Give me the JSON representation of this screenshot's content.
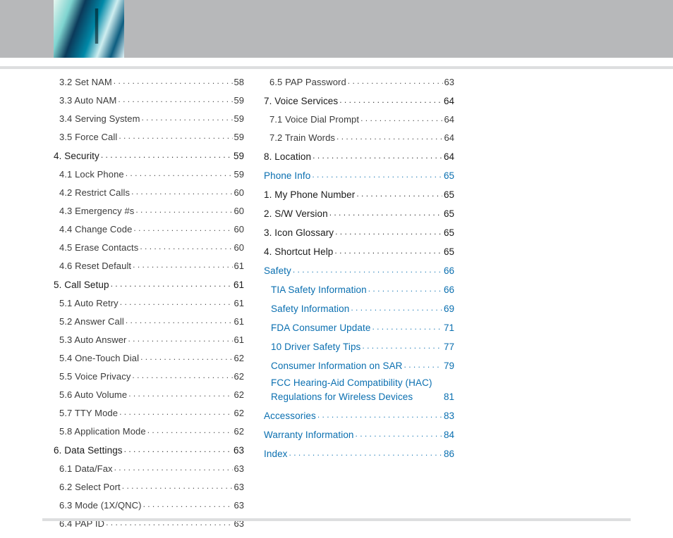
{
  "columns": [
    [
      {
        "style": "indent1",
        "label": "3.2 Set NAM",
        "page": "58"
      },
      {
        "style": "indent1",
        "label": "3.3 Auto NAM",
        "page": "59"
      },
      {
        "style": "indent1",
        "label": "3.4 Serving System",
        "page": "59"
      },
      {
        "style": "indent1",
        "label": "3.5 Force Call",
        "page": "59"
      },
      {
        "style": "section",
        "label": "4. Security",
        "page": "59"
      },
      {
        "style": "indent1",
        "label": "4.1 Lock Phone",
        "page": "59"
      },
      {
        "style": "indent1",
        "label": "4.2 Restrict Calls",
        "page": "60"
      },
      {
        "style": "indent1",
        "label": "4.3 Emergency #s",
        "page": "60"
      },
      {
        "style": "indent1",
        "label": "4.4 Change Code",
        "page": "60"
      },
      {
        "style": "indent1",
        "label": "4.5 Erase Contacts",
        "page": "60"
      },
      {
        "style": "indent1",
        "label": "4.6 Reset Default",
        "page": "61"
      },
      {
        "style": "section",
        "label": "5. Call Setup",
        "page": "61"
      },
      {
        "style": "indent1",
        "label": "5.1 Auto Retry",
        "page": "61"
      },
      {
        "style": "indent1",
        "label": "5.2 Answer Call",
        "page": "61"
      },
      {
        "style": "indent1",
        "label": "5.3 Auto Answer",
        "page": "61"
      },
      {
        "style": "indent1",
        "label": "5.4 One-Touch Dial",
        "page": "62"
      },
      {
        "style": "indent1",
        "label": "5.5 Voice Privacy",
        "page": "62"
      },
      {
        "style": "indent1",
        "label": "5.6 Auto Volume",
        "page": "62"
      },
      {
        "style": "indent1",
        "label": "5.7 TTY Mode",
        "page": "62"
      },
      {
        "style": "indent1",
        "label": "5.8 Application Mode",
        "page": "62"
      },
      {
        "style": "section",
        "label": "6. Data Settings",
        "page": "63"
      },
      {
        "style": "indent1",
        "label": "6.1 Data/Fax",
        "page": "63"
      },
      {
        "style": "indent1",
        "label": "6.2 Select Port",
        "page": "63"
      },
      {
        "style": "indent1",
        "label": "6.3 Mode (1X/QNC)",
        "page": "63"
      },
      {
        "style": "indent1",
        "label": "6.4 PAP ID",
        "page": "63"
      }
    ],
    [
      {
        "style": "indent1",
        "label": "6.5 PAP Password",
        "page": "63"
      },
      {
        "style": "section",
        "label": "7. Voice Services",
        "page": "64"
      },
      {
        "style": "indent1",
        "label": "7.1 Voice Dial Prompt",
        "page": "64"
      },
      {
        "style": "indent1",
        "label": "7.2 Train Words",
        "page": "64"
      },
      {
        "style": "section",
        "label": "8. Location",
        "page": "64"
      },
      {
        "style": "link",
        "label": "Phone Info",
        "page": "65"
      },
      {
        "style": "section",
        "label": "1. My Phone Number",
        "page": "65"
      },
      {
        "style": "section",
        "label": "2. S/W Version",
        "page": "65"
      },
      {
        "style": "section",
        "label": "3. Icon Glossary",
        "page": "65"
      },
      {
        "style": "section",
        "label": "4. Shortcut Help",
        "page": "65"
      },
      {
        "style": "link",
        "label": "Safety",
        "page": "66",
        "spaced": true
      },
      {
        "style": "link",
        "label": "TIA Safety Information",
        "page": "66",
        "indent": true
      },
      {
        "style": "link",
        "label": "Safety Information",
        "page": "69",
        "indent": true
      },
      {
        "style": "link",
        "label": "FDA Consumer Update",
        "page": "71",
        "indent": true
      },
      {
        "style": "link",
        "label": "10 Driver Safety Tips",
        "page": "77",
        "indent": true
      },
      {
        "style": "link",
        "label": "Consumer Information on SAR",
        "page": "79",
        "indent": true
      },
      {
        "style": "link",
        "multiline": [
          "FCC Hearing-Aid Compatibility (HAC)",
          "Regulations for Wireless Devices"
        ],
        "page": "81",
        "indent": true,
        "nodots": true
      },
      {
        "style": "link",
        "label": "Accessories",
        "page": "83",
        "spaced": true
      },
      {
        "style": "link",
        "label": "Warranty Information",
        "page": "84",
        "spaced": true
      },
      {
        "style": "link",
        "label": "Index",
        "page": "86",
        "spaced": true
      }
    ]
  ]
}
